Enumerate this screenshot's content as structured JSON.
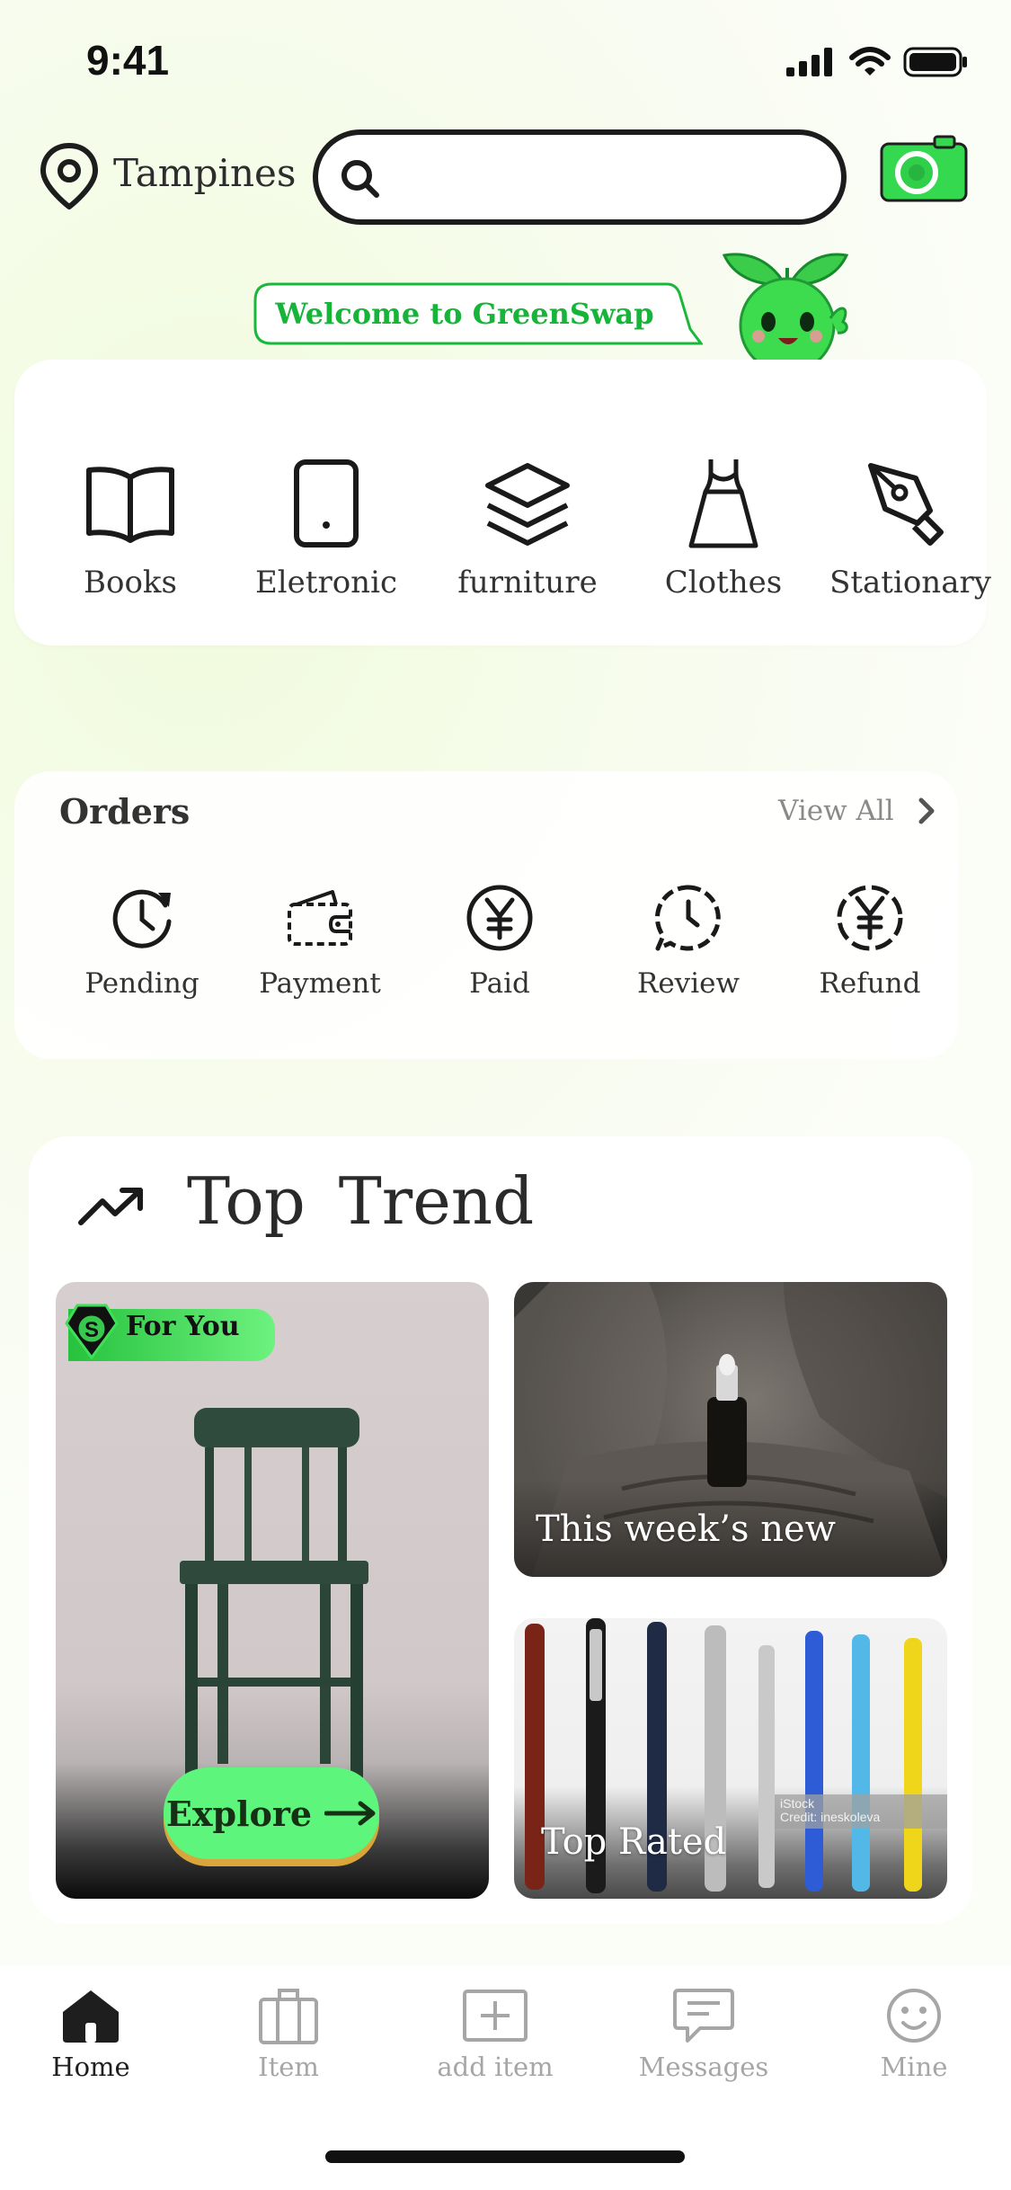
{
  "status_bar": {
    "time": "9:41"
  },
  "header": {
    "location": "Tampines",
    "search_placeholder": "",
    "icons": {
      "location": "location-pin-icon",
      "search": "search-icon",
      "camera": "camera-icon"
    }
  },
  "welcome": {
    "message": "Welcome to GreenSwap",
    "mascot": "sprout-mascot"
  },
  "categories": [
    {
      "label": "Books",
      "icon": "book-icon"
    },
    {
      "label": "Eletronic",
      "icon": "phone-icon"
    },
    {
      "label": "furniture",
      "icon": "layers-icon"
    },
    {
      "label": "Clothes",
      "icon": "dress-icon"
    },
    {
      "label": "Stationary",
      "icon": "pen-nib-icon"
    }
  ],
  "orders": {
    "title": "Orders",
    "view_all": "View All",
    "items": [
      {
        "label": "Pending",
        "icon": "clock-refresh-icon"
      },
      {
        "label": "Payment",
        "icon": "wallet-icon"
      },
      {
        "label": "Paid",
        "icon": "yen-coin-icon"
      },
      {
        "label": "Review",
        "icon": "chat-bubble-icon"
      },
      {
        "label": "Refund",
        "icon": "yen-refund-icon"
      }
    ]
  },
  "top_trend": {
    "title": "Top Trend",
    "tiles": {
      "featured": {
        "badge": "For You",
        "button": "Explore"
      },
      "new": {
        "caption": "This week’s new"
      },
      "rated": {
        "caption": "Top Rated",
        "watermark_1": "iStock",
        "watermark_2": "Credit: ineskoleva"
      }
    }
  },
  "tabbar": {
    "tabs": [
      {
        "label": "Home",
        "icon": "home-icon",
        "active": true
      },
      {
        "label": "Item",
        "icon": "briefcase-icon",
        "active": false
      },
      {
        "label": "add item",
        "icon": "add-square-icon",
        "active": false
      },
      {
        "label": "Messages",
        "icon": "message-icon",
        "active": false
      },
      {
        "label": "Mine",
        "icon": "smiley-icon",
        "active": false
      }
    ]
  },
  "colors": {
    "accent": "#17b43a",
    "button": "#5df57c",
    "inactive": "#a6a6a6"
  }
}
